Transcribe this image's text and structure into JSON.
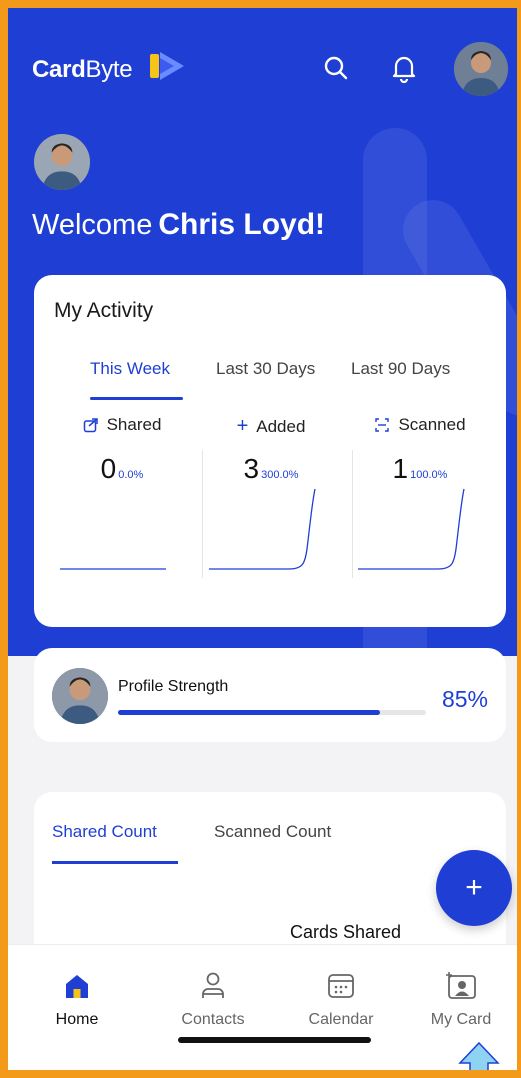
{
  "header": {
    "logo_bold": "Card",
    "logo_light": "Byte"
  },
  "welcome": {
    "greeting": "Welcome",
    "name": "Chris Loyd!"
  },
  "activity": {
    "title": "My Activity",
    "tabs": [
      {
        "label": "This Week",
        "active": true
      },
      {
        "label": "Last 30 Days",
        "active": false
      },
      {
        "label": "Last 90 Days",
        "active": false
      }
    ],
    "stats": [
      {
        "label": "Shared",
        "value": "0",
        "change": "0.0%",
        "icon": "share-icon"
      },
      {
        "label": "Added",
        "value": "3",
        "change": "300.0%",
        "icon": "plus-icon"
      },
      {
        "label": "Scanned",
        "value": "1",
        "change": "100.0%",
        "icon": "scan-icon"
      }
    ]
  },
  "profile": {
    "label": "Profile Strength",
    "percent_text": "85%",
    "fill_fraction": 0.85
  },
  "counts": {
    "tabs": [
      {
        "label": "Shared Count",
        "active": true
      },
      {
        "label": "Scanned Count",
        "active": false
      }
    ],
    "cards_shared_label": "Cards Shared"
  },
  "fab": {
    "label": "+"
  },
  "nav": {
    "items": [
      {
        "label": "Home",
        "icon": "home-icon",
        "active": true
      },
      {
        "label": "Contacts",
        "icon": "contacts-icon",
        "active": false
      },
      {
        "label": "Calendar",
        "icon": "calendar-icon",
        "active": false
      },
      {
        "label": "My Card",
        "icon": "my-card-icon",
        "active": false
      }
    ]
  },
  "colors": {
    "primary": "#1f3fd4",
    "frame": "#f39a1a",
    "logo_yellow": "#f6c416",
    "logo_blue": "#6a8cff",
    "arrow": "#8fd3f3"
  }
}
